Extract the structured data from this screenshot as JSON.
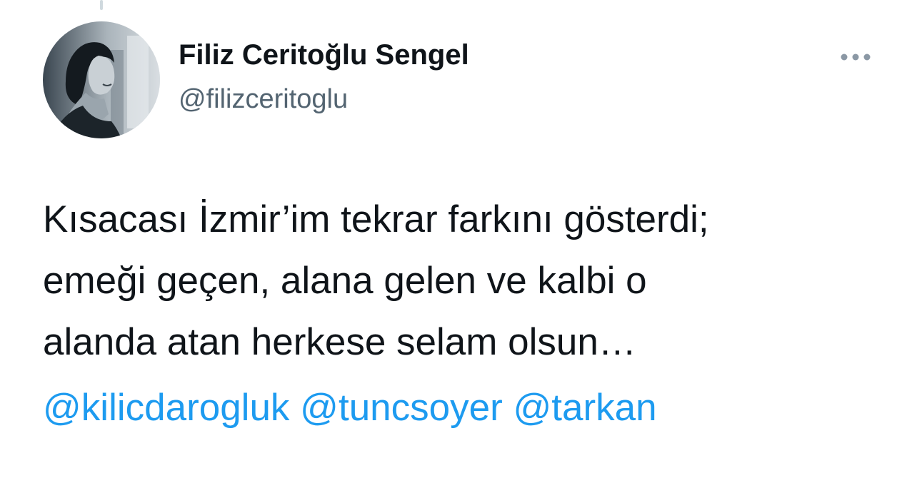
{
  "colors": {
    "text_primary": "#0f1419",
    "text_secondary": "#536471",
    "link": "#1d9bf0",
    "icon": "#8b98a5"
  },
  "author": {
    "display_name": "Filiz Ceritoğlu Sengel",
    "handle": "@filizceritoglu",
    "avatar_icon": "avatar-photo"
  },
  "menu": {
    "icon": "more-horizontal-icon"
  },
  "tweet": {
    "lines": [
      "Kısacası İzmir’im tekrar farkını gösterdi;",
      "emeği geçen, alana gelen ve kalbi o",
      "alanda atan herkese selam olsun…"
    ],
    "mentions": [
      "@kilicdarogluk",
      "@tuncsoyer",
      "@tarkan"
    ]
  }
}
